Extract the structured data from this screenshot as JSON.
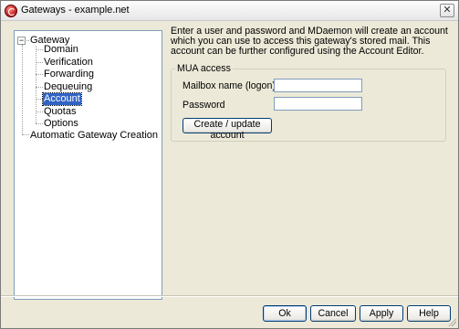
{
  "window": {
    "title": "Gateways - example.net",
    "close_label": "✕"
  },
  "tree": {
    "root_label": "Gateway",
    "root_expander": "−",
    "children": [
      "Domain",
      "Verification",
      "Forwarding",
      "Dequeuing",
      "Account",
      "Quotas",
      "Options"
    ],
    "selected": "Account",
    "sibling_label": "Automatic Gateway Creation"
  },
  "content": {
    "intro": "Enter a user and password and MDaemon will create an account which you can use to access this gateway's stored mail.  This account can be further configured using the Account Editor.",
    "group_title": "MUA access",
    "mailbox_label": "Mailbox name (logon)",
    "mailbox_value": "",
    "password_label": "Password",
    "password_value": "",
    "create_button": "Create / update account"
  },
  "footer": {
    "ok": "Ok",
    "cancel": "Cancel",
    "apply": "Apply",
    "help": "Help"
  }
}
